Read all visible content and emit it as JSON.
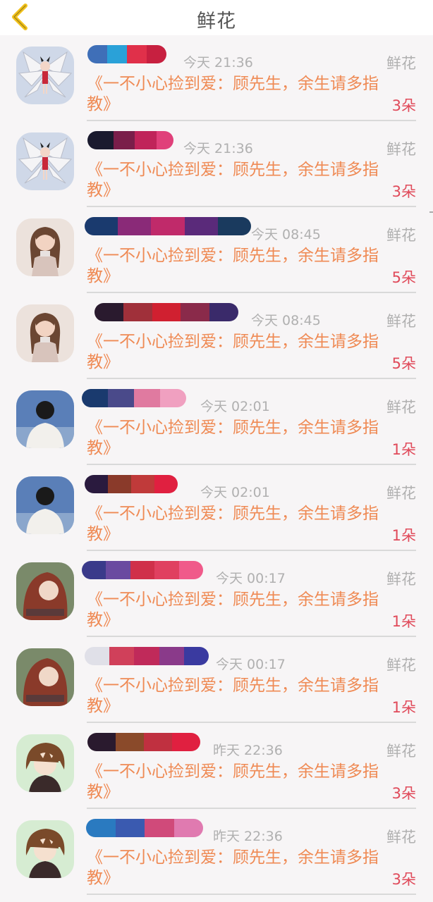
{
  "header": {
    "title": "鲜花",
    "back_icon": "chevron-left-icon",
    "accent": "#f2c21b"
  },
  "colors": {
    "book": "#ef8a54",
    "count": "#e04a5a",
    "meta": "#b0b0b0"
  },
  "items": [
    {
      "time": "今天 21:36",
      "tag": "鲜花",
      "book": "《一不小心捡到爱：顾先生，余生请多指教》",
      "count": "3朵",
      "avatar": "fox-girl"
    },
    {
      "time": "今天 21:36",
      "tag": "鲜花",
      "book": "《一不小心捡到爱：顾先生，余生请多指教》",
      "count": "3朵",
      "avatar": "fox-girl"
    },
    {
      "time": "今天 08:45",
      "tag": "鲜花",
      "book": "《一不小心捡到爱：顾先生，余生请多指教》",
      "count": "5朵",
      "avatar": "little-girl"
    },
    {
      "time": "今天 08:45",
      "tag": "鲜花",
      "book": "《一不小心捡到爱：顾先生，余生请多指教》",
      "count": "5朵",
      "avatar": "little-girl"
    },
    {
      "time": "今天 02:01",
      "tag": "鲜花",
      "book": "《一不小心捡到爱：顾先生，余生请多指教》",
      "count": "1朵",
      "avatar": "man-back"
    },
    {
      "time": "今天 02:01",
      "tag": "鲜花",
      "book": "《一不小心捡到爱：顾先生，余生请多指教》",
      "count": "1朵",
      "avatar": "man-back"
    },
    {
      "time": "今天 00:17",
      "tag": "鲜花",
      "book": "《一不小心捡到爱：顾先生，余生请多指教》",
      "count": "1朵",
      "avatar": "redhead"
    },
    {
      "time": "今天 00:17",
      "tag": "鲜花",
      "book": "《一不小心捡到爱：顾先生，余生请多指教》",
      "count": "1朵",
      "avatar": "redhead"
    },
    {
      "time": "昨天 22:36",
      "tag": "鲜花",
      "book": "《一不小心捡到爱：顾先生，余生请多指教》",
      "count": "3朵",
      "avatar": "anime-boy"
    },
    {
      "time": "昨天 22:36",
      "tag": "鲜花",
      "book": "《一不小心捡到爱：顾先生，余生请多指教》",
      "count": "3朵",
      "avatar": "anime-boy"
    }
  ]
}
